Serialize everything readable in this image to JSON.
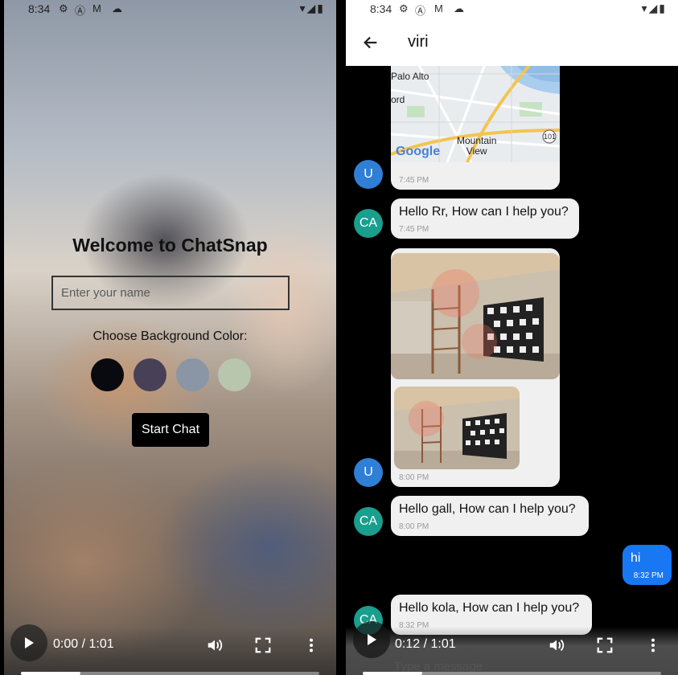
{
  "status_bar": {
    "time": "8:34"
  },
  "left": {
    "title": "Welcome to ChatSnap",
    "name_placeholder": "Enter your name",
    "color_label": "Choose Background Color:",
    "swatch_colors": [
      "#090A0F",
      "#474056",
      "#8A95A5",
      "#B9C6AE"
    ],
    "start_button": "Start Chat",
    "video": {
      "time": "0:00 / 1:01",
      "progress": 0.2
    }
  },
  "right": {
    "title": "viri",
    "messages": [
      {
        "avatar": "U",
        "type": "map",
        "time": "7:45 PM",
        "map_labels": {
          "palo_alto": "Palo Alto",
          "ord": "ord",
          "mountain_view": "Mountain\nView",
          "google": "Google",
          "highway": "101"
        }
      },
      {
        "avatar": "CA",
        "text": "Hello Rr, How can I help you?",
        "time": "7:45 PM"
      },
      {
        "avatar": "U",
        "type": "images",
        "time": "8:00 PM"
      },
      {
        "avatar": "CA",
        "text": "Hello gall, How can I help you?",
        "time": "8:00 PM"
      },
      {
        "sent": true,
        "text": "hi",
        "time": "8:32 PM"
      },
      {
        "avatar": "CA",
        "text": "Hello kola, How can I help you?",
        "time": "8:32 PM"
      }
    ],
    "input_placeholder": "Type a message",
    "video": {
      "time": "0:12 / 1:01",
      "progress": 0.2
    }
  },
  "colors": {
    "avatar_user": "#2F7FD6",
    "avatar_ca": "#1A9E8D",
    "sent_bubble": "#1877F2",
    "received_bubble": "#F0F0F0"
  }
}
